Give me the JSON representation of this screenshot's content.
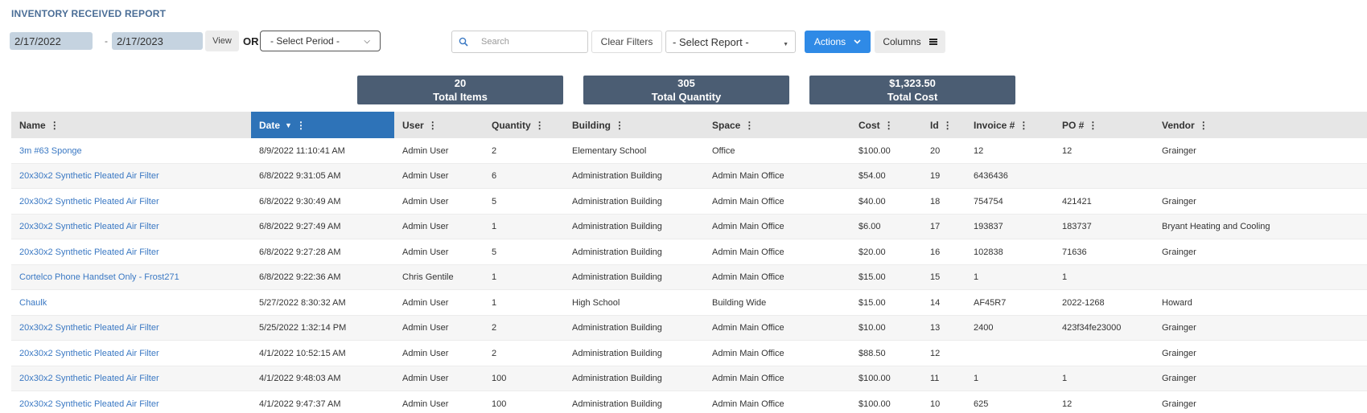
{
  "page": {
    "title": "INVENTORY RECEIVED REPORT"
  },
  "filters": {
    "date_from": "2/17/2022",
    "date_to": "2/17/2023",
    "dash": "-",
    "view_label": "View",
    "or_label": "OR",
    "period_placeholder": "- Select Period -",
    "search_placeholder": "Search",
    "clear_label": "Clear Filters",
    "report_placeholder": "- Select Report -",
    "actions_label": "Actions",
    "columns_label": "Columns"
  },
  "stats": [
    {
      "value": "20",
      "label": "Total Items"
    },
    {
      "value": "305",
      "label": "Total Quantity"
    },
    {
      "value": "$1,323.50",
      "label": "Total Cost"
    }
  ],
  "table": {
    "columns": [
      "Name",
      "Date",
      "User",
      "Quantity",
      "Building",
      "Space",
      "Cost",
      "Id",
      "Invoice #",
      "PO #",
      "Vendor"
    ],
    "sorted_column": "Date",
    "sort_direction": "descending",
    "rows": [
      [
        "3m #63 Sponge",
        "8/9/2022 11:10:41 AM",
        "Admin User",
        "2",
        "Elementary School",
        "Office",
        "$100.00",
        "20",
        "12",
        "12",
        "Grainger"
      ],
      [
        "20x30x2 Synthetic Pleated Air Filter",
        "6/8/2022 9:31:05 AM",
        "Admin User",
        "6",
        "Administration Building",
        "Admin Main Office",
        "$54.00",
        "19",
        "6436436",
        "",
        ""
      ],
      [
        "20x30x2 Synthetic Pleated Air Filter",
        "6/8/2022 9:30:49 AM",
        "Admin User",
        "5",
        "Administration Building",
        "Admin Main Office",
        "$40.00",
        "18",
        "754754",
        "421421",
        "Grainger"
      ],
      [
        "20x30x2 Synthetic Pleated Air Filter",
        "6/8/2022 9:27:49 AM",
        "Admin User",
        "1",
        "Administration Building",
        "Admin Main Office",
        "$6.00",
        "17",
        "193837",
        "183737",
        "Bryant Heating and Cooling"
      ],
      [
        "20x30x2 Synthetic Pleated Air Filter",
        "6/8/2022 9:27:28 AM",
        "Admin User",
        "5",
        "Administration Building",
        "Admin Main Office",
        "$20.00",
        "16",
        "102838",
        "71636",
        "Grainger"
      ],
      [
        "Cortelco Phone Handset Only - Frost271",
        "6/8/2022 9:22:36 AM",
        "Chris Gentile",
        "1",
        "Administration Building",
        "Admin Main Office",
        "$15.00",
        "15",
        "1",
        "1",
        ""
      ],
      [
        "Chaulk",
        "5/27/2022 8:30:32 AM",
        "Admin User",
        "1",
        "High School",
        "Building Wide",
        "$15.00",
        "14",
        "AF45R7",
        "2022-1268",
        "Howard"
      ],
      [
        "20x30x2 Synthetic Pleated Air Filter",
        "5/25/2022 1:32:14 PM",
        "Admin User",
        "2",
        "Administration Building",
        "Admin Main Office",
        "$10.00",
        "13",
        "2400",
        "423f34fe23000",
        "Grainger"
      ],
      [
        "20x30x2 Synthetic Pleated Air Filter",
        "4/1/2022 10:52:15 AM",
        "Admin User",
        "2",
        "Administration Building",
        "Admin Main Office",
        "$88.50",
        "12",
        "",
        "",
        "Grainger"
      ],
      [
        "20x30x2 Synthetic Pleated Air Filter",
        "4/1/2022 9:48:03 AM",
        "Admin User",
        "100",
        "Administration Building",
        "Admin Main Office",
        "$100.00",
        "11",
        "1",
        "1",
        "Grainger"
      ],
      [
        "20x30x2 Synthetic Pleated Air Filter",
        "4/1/2022 9:47:37 AM",
        "Admin User",
        "100",
        "Administration Building",
        "Admin Main Office",
        "$100.00",
        "10",
        "625",
        "12",
        "Grainger"
      ]
    ]
  },
  "colors": {
    "title": "#4a6d96",
    "accent": "#2f8ae6",
    "active_header": "#2e73b8",
    "stat_bg": "#4b5d73",
    "link": "#3a78c3"
  }
}
